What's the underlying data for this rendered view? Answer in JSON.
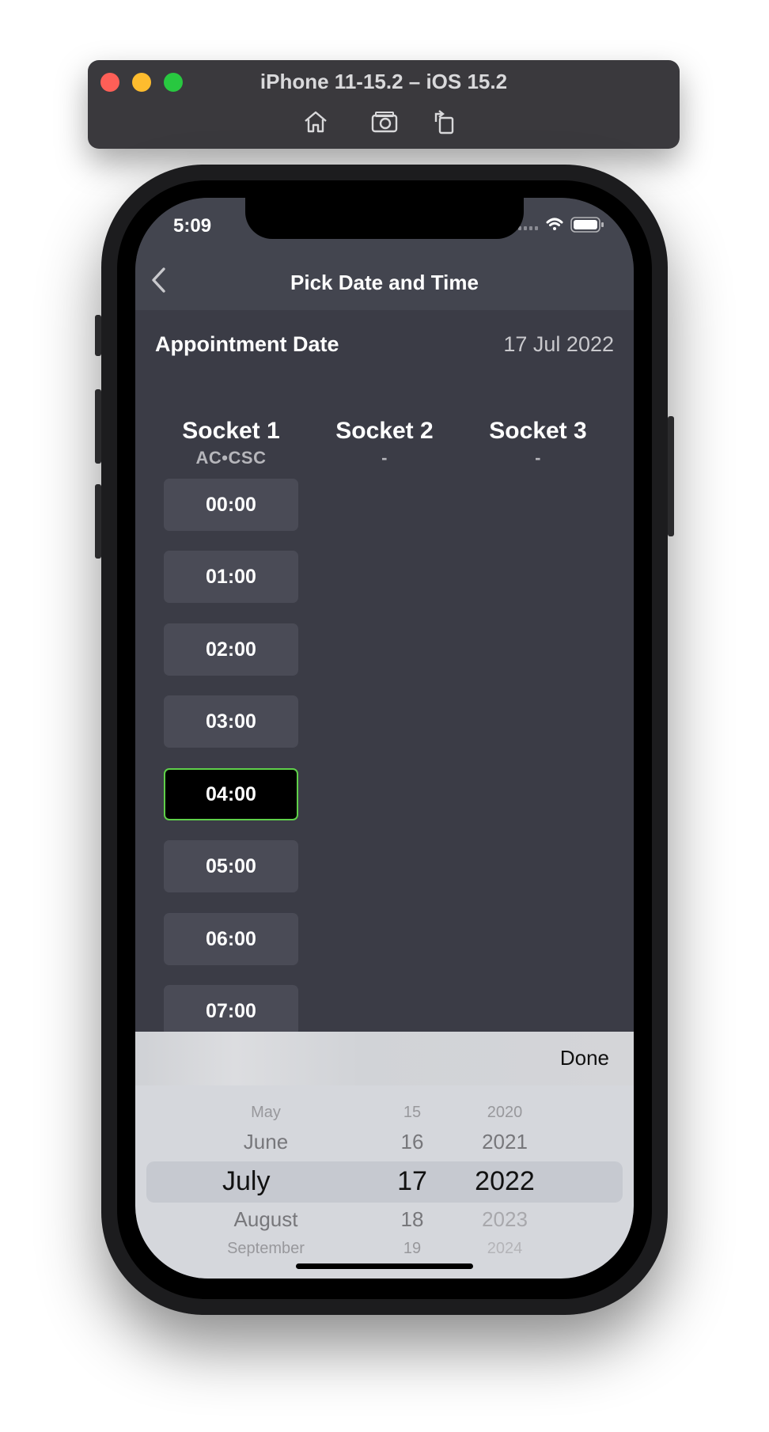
{
  "simulator": {
    "title": "iPhone 11-15.2 – iOS 15.2",
    "toolbar_icons": [
      "home-icon",
      "screenshot-icon",
      "rotate-icon"
    ]
  },
  "status_bar": {
    "time": "5:09",
    "icons": [
      "cellular-signal-icon",
      "wifi-icon",
      "battery-icon"
    ]
  },
  "nav": {
    "title": "Pick Date and Time",
    "back_icon": "chevron-left-icon"
  },
  "appointment": {
    "label": "Appointment Date",
    "value": "17 Jul 2022"
  },
  "sockets": [
    {
      "name": "Socket 1",
      "sub": "AC•CSC"
    },
    {
      "name": "Socket 2",
      "sub": "-"
    },
    {
      "name": "Socket 3",
      "sub": "-"
    }
  ],
  "time_slots": [
    "00:00",
    "01:00",
    "02:00",
    "03:00",
    "04:00",
    "05:00",
    "06:00",
    "07:00"
  ],
  "selected_slot": "04:00",
  "picker": {
    "done_label": "Done",
    "months": [
      "May",
      "June",
      "July",
      "August",
      "September"
    ],
    "days": [
      "15",
      "16",
      "17",
      "18",
      "19"
    ],
    "years": [
      "2020",
      "2021",
      "2022",
      "2023",
      "2024"
    ]
  },
  "colors": {
    "screen_bg": "#3b3c46",
    "nav_bg": "#43454f",
    "slot_bg": "#4a4b56",
    "selected_border": "#5fd04a",
    "picker_bg": "#d5d7dc"
  }
}
